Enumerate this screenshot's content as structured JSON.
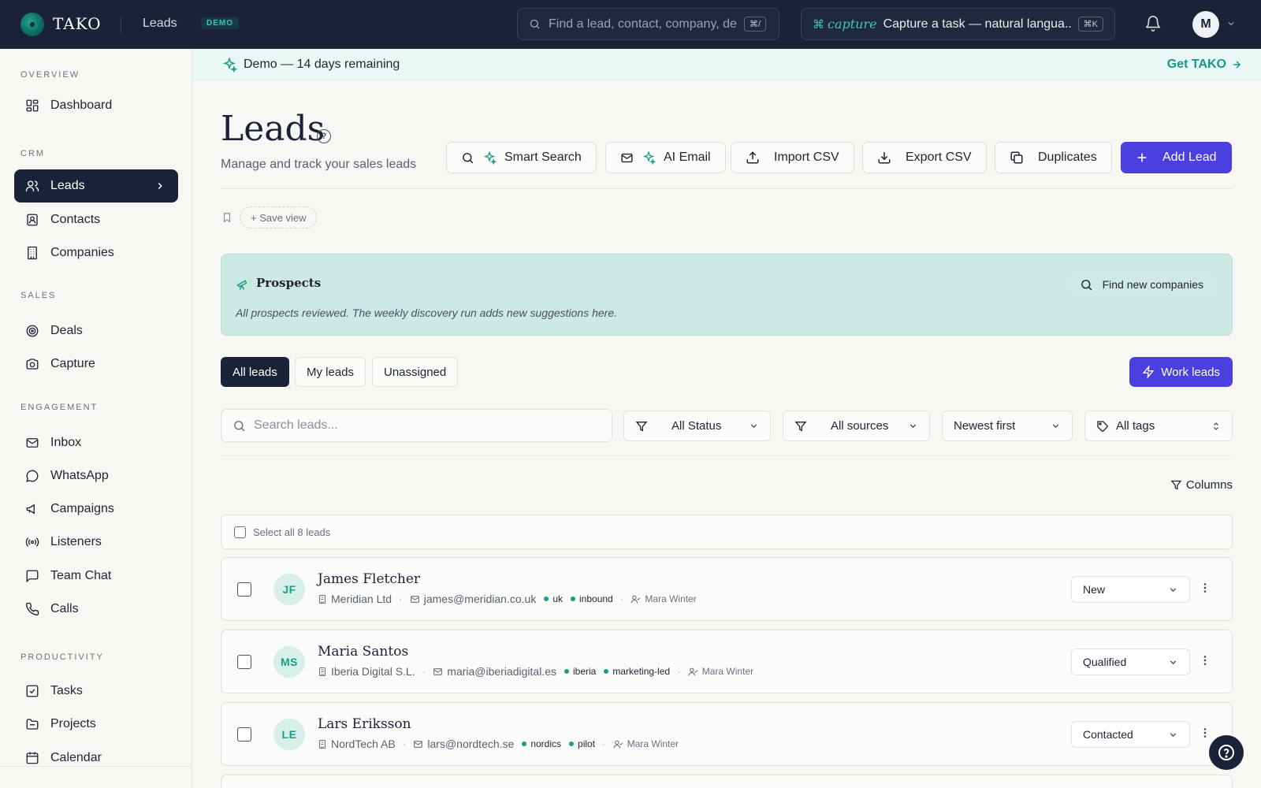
{
  "app": {
    "logo": "TAKO",
    "section": "Leads",
    "badge": "DEMO",
    "search_placeholder": "Find a lead, contact, company, de",
    "search_shortcut": "⌘/",
    "capture_label": "capture",
    "capture_placeholder": "Capture a task — natural langua...",
    "capture_shortcut": "⌘K",
    "user_initial": "M"
  },
  "sidebar": {
    "sections": [
      {
        "heading": "OVERVIEW",
        "items": [
          {
            "label": "Dashboard",
            "icon": "dashboard-icon"
          }
        ]
      },
      {
        "heading": "CRM",
        "items": [
          {
            "label": "Leads",
            "icon": "users-icon"
          },
          {
            "label": "Contacts",
            "icon": "contact-card-icon"
          },
          {
            "label": "Companies",
            "icon": "building-icon"
          }
        ]
      },
      {
        "heading": "SALES",
        "items": [
          {
            "label": "Deals",
            "icon": "target-icon"
          },
          {
            "label": "Capture",
            "icon": "camera-icon"
          }
        ]
      },
      {
        "heading": "ENGAGEMENT",
        "items": [
          {
            "label": "Inbox",
            "icon": "mail-icon"
          },
          {
            "label": "WhatsApp",
            "icon": "chat-bubble-icon"
          },
          {
            "label": "Campaigns",
            "icon": "megaphone-icon"
          },
          {
            "label": "Listeners",
            "icon": "broadcast-icon"
          },
          {
            "label": "Team Chat",
            "icon": "message-square-icon"
          },
          {
            "label": "Calls",
            "icon": "phone-icon"
          }
        ]
      },
      {
        "heading": "PRODUCTIVITY",
        "items": [
          {
            "label": "Tasks",
            "icon": "checkbox-icon"
          },
          {
            "label": "Projects",
            "icon": "folder-icon"
          },
          {
            "label": "Calendar",
            "icon": "calendar-icon"
          }
        ]
      }
    ]
  },
  "banner": {
    "text": "Demo — 14 days remaining",
    "cta": "Get TAKO"
  },
  "header": {
    "title": "Leads",
    "subtitle": "Manage and track your sales leads",
    "actions": {
      "smart_search": "Smart Search",
      "ai_email": "AI Email",
      "import_csv": "Import CSV",
      "export_csv": "Export CSV",
      "duplicates": "Duplicates",
      "add_lead": "Add Lead"
    }
  },
  "views": {
    "save_view": "+ Save view"
  },
  "prospects": {
    "title": "Prospects",
    "description": "All prospects reviewed. The weekly discovery run adds new suggestions here.",
    "find_button": "Find new companies"
  },
  "tabs": [
    "All leads",
    "My leads",
    "Unassigned"
  ],
  "work_leads": "Work leads",
  "filters": {
    "search_placeholder": "Search leads...",
    "status": "All Status",
    "sources": "All sources",
    "sort": "Newest first",
    "tags": "All tags"
  },
  "columns_label": "Columns",
  "select_all": "Select all 8 leads",
  "leads": [
    {
      "initials": "JF",
      "name": "James Fletcher",
      "company": "Meridian Ltd",
      "email": "james@meridian.co.uk",
      "tags": [
        "uk",
        "inbound"
      ],
      "owner": "Mara Winter",
      "status": "New"
    },
    {
      "initials": "MS",
      "name": "Maria Santos",
      "company": "Iberia Digital S.L.",
      "email": "maria@iberiadigital.es",
      "tags": [
        "iberia",
        "marketing-led"
      ],
      "owner": "Mara Winter",
      "status": "Qualified"
    },
    {
      "initials": "LE",
      "name": "Lars Eriksson",
      "company": "NordTech AB",
      "email": "lars@nordtech.se",
      "tags": [
        "nordics",
        "pilot"
      ],
      "owner": "Mara Winter",
      "status": "Contacted"
    }
  ],
  "colors": {
    "navy": "#1b2238",
    "accent": "#4b3fe0",
    "teal": "#1a9d89",
    "prospect_bg": "#cde9e3"
  }
}
